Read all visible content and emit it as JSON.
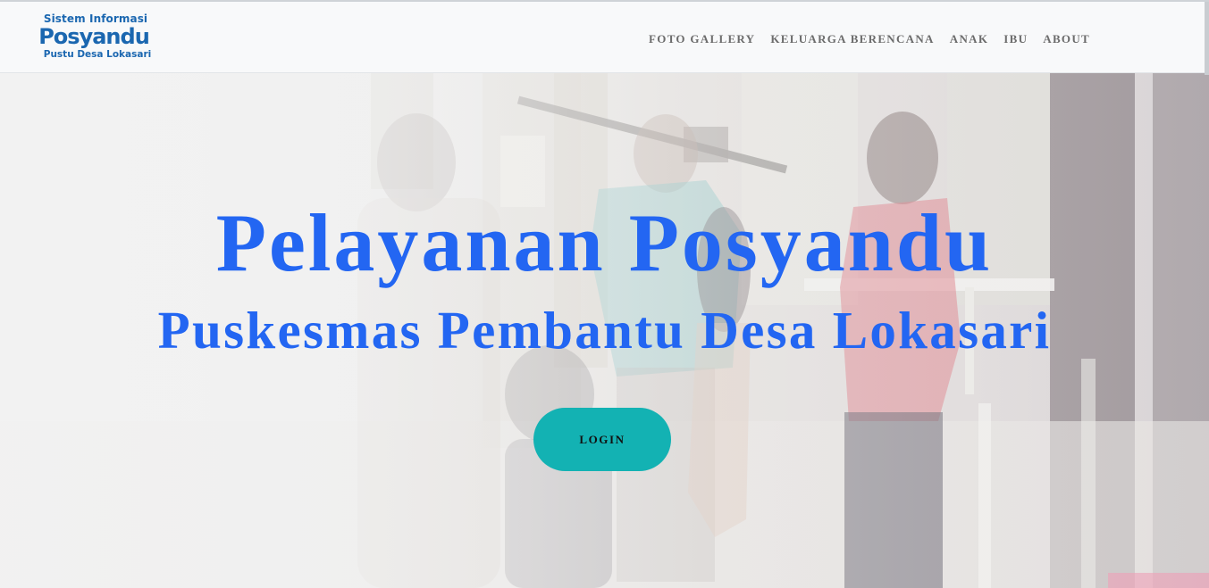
{
  "header": {
    "logo": {
      "line1": "Sistem Informasi",
      "line2": "Posyandu",
      "line3": "Pustu Desa Lokasari",
      "color": "#1b67b0"
    },
    "nav": [
      {
        "label": "FOTO GALLERY"
      },
      {
        "label": "KELUARGA BERENCANA"
      },
      {
        "label": "ANAK"
      },
      {
        "label": "IBU"
      },
      {
        "label": "ABOUT"
      }
    ]
  },
  "hero": {
    "title": "Pelayanan Posyandu",
    "subtitle": "Puskesmas Pembantu Desa Lokasari",
    "login_label": "LOGIN",
    "title_color": "#2366f2",
    "button_color": "#13b2b3"
  }
}
